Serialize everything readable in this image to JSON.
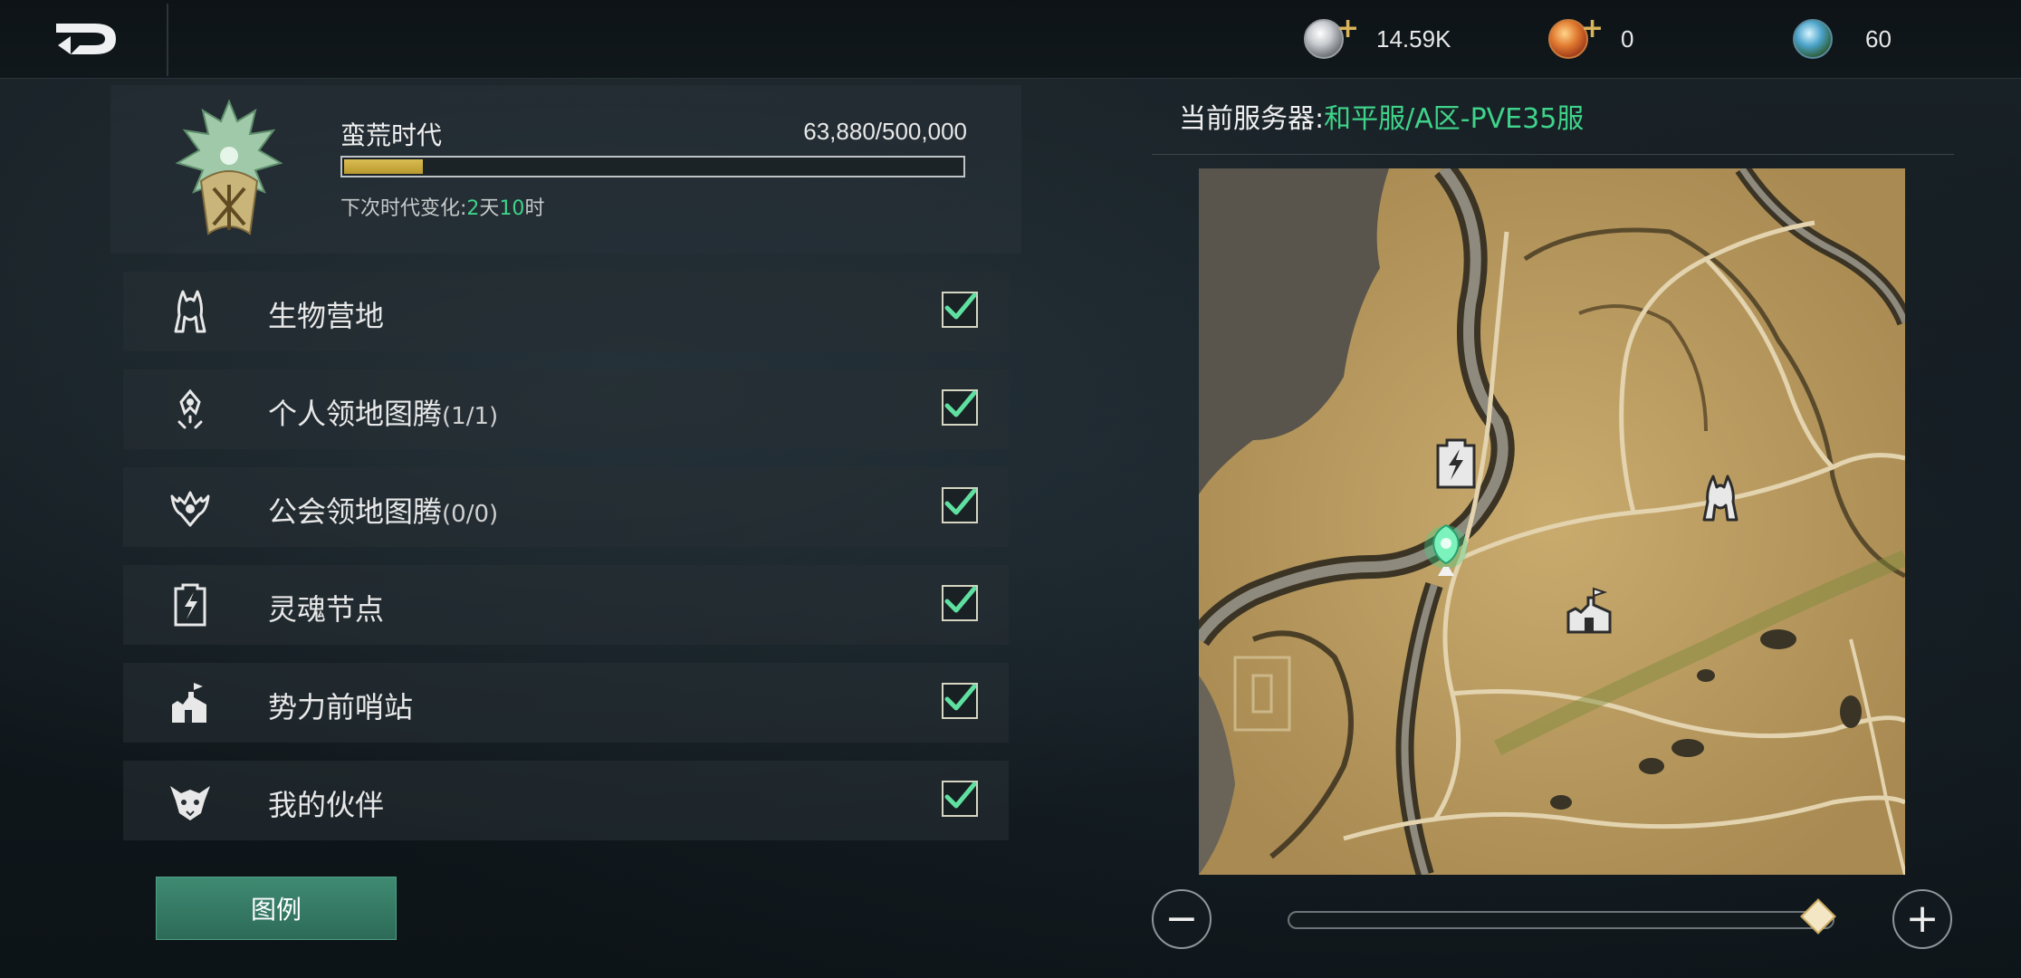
{
  "topbar": {
    "currencies": [
      {
        "name": "silver",
        "amount": "14.59K",
        "has_plus": true,
        "color": "#c9ccd0"
      },
      {
        "name": "copper",
        "amount": "0",
        "has_plus": true,
        "color": "#d05a2a"
      },
      {
        "name": "crystal",
        "amount": "60",
        "has_plus": false,
        "color": "#4aa2c8"
      }
    ]
  },
  "era": {
    "name": "蛮荒时代",
    "progress_text": "63,880/500,000",
    "progress_fraction": 0.1278,
    "next_label": "下次时代变化:",
    "days": "2",
    "day_unit": "天",
    "hours": "10",
    "hour_unit": "时"
  },
  "filters": [
    {
      "label": "生物营地",
      "count": "",
      "icon": "creature-camp-icon",
      "checked": true
    },
    {
      "label": "个人领地图腾",
      "count": "(1/1)",
      "icon": "personal-totem-icon",
      "checked": true
    },
    {
      "label": "公会领地图腾",
      "count": "(0/0)",
      "icon": "guild-totem-icon",
      "checked": true
    },
    {
      "label": "灵魂节点",
      "count": "",
      "icon": "soul-node-icon",
      "checked": true
    },
    {
      "label": "势力前哨站",
      "count": "",
      "icon": "faction-outpost-icon",
      "checked": true
    },
    {
      "label": "我的伙伴",
      "count": "",
      "icon": "companion-icon",
      "checked": true
    }
  ],
  "legend_button": "图例",
  "server": {
    "label": "当前服务器:",
    "value": "和平服/A区-PVE35服"
  },
  "zoom": {
    "level": 0.97,
    "minus": "−",
    "plus": "+"
  },
  "colors": {
    "accent_green": "#3fd38a",
    "progress_gold": "#d9bd52",
    "button_green": "#3f8a72"
  }
}
